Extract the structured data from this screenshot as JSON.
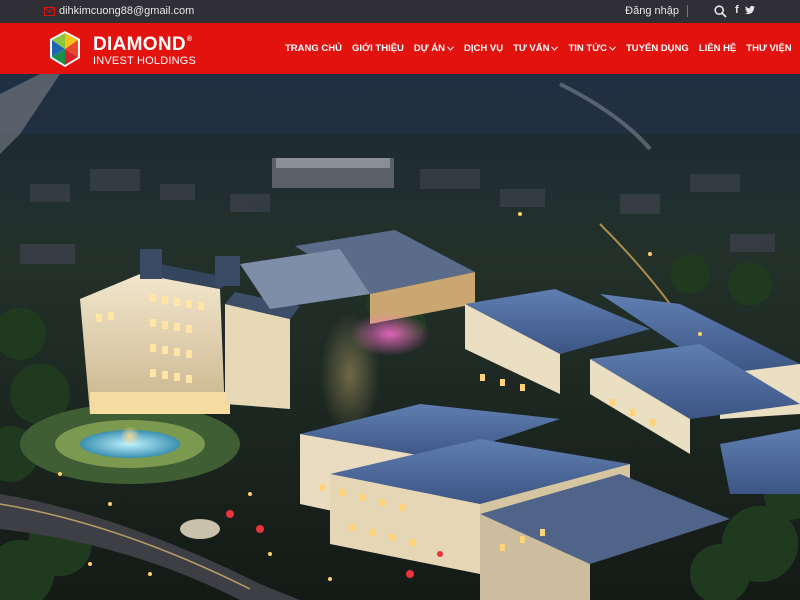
{
  "topbar": {
    "email": "dihkimcuong88@gmail.com",
    "login": "Đăng nhập",
    "facebook": "f"
  },
  "logo": {
    "brand": "DIAMOND",
    "reg": "®",
    "subtitle": "INVEST HOLDINGS"
  },
  "nav": {
    "items": [
      {
        "label": "TRANG CHỦ"
      },
      {
        "label": "GIỚI THIỆU"
      },
      {
        "label": "DỰ ÁN"
      },
      {
        "label": "DỊCH VỤ"
      },
      {
        "label": "TƯ VẤN"
      },
      {
        "label": "TIN TỨC"
      },
      {
        "label": "TUYỂN DỤNG"
      },
      {
        "label": "LIÊN HỆ"
      },
      {
        "label": "THƯ VIỆN"
      }
    ]
  },
  "colors": {
    "header": "#e2120f",
    "topbar": "#2f2f35"
  },
  "icons": [
    "email-icon",
    "search-icon",
    "facebook-icon",
    "twitter-icon",
    "chevron-down-icon",
    "diamond-logo-icon"
  ]
}
